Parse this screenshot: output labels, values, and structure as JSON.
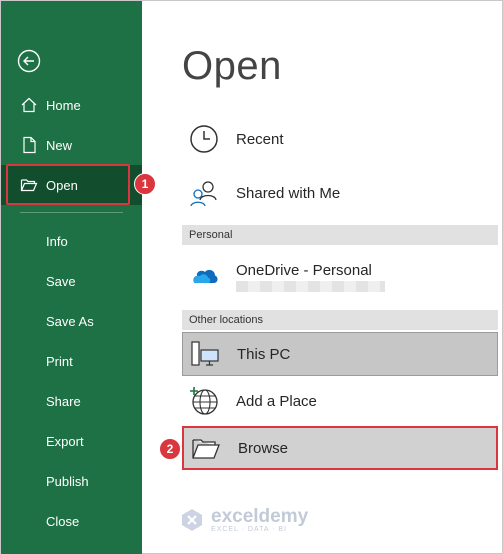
{
  "sidebar": {
    "items": [
      {
        "label": "Home",
        "icon": "home-icon"
      },
      {
        "label": "New",
        "icon": "new-document-icon"
      },
      {
        "label": "Open",
        "icon": "open-folder-icon"
      },
      {
        "label": "Info"
      },
      {
        "label": "Save"
      },
      {
        "label": "Save As"
      },
      {
        "label": "Print"
      },
      {
        "label": "Share"
      },
      {
        "label": "Export"
      },
      {
        "label": "Publish"
      },
      {
        "label": "Close"
      }
    ]
  },
  "main": {
    "title": "Open",
    "recent": "Recent",
    "shared": "Shared with Me",
    "personal_header": "Personal",
    "onedrive": "OneDrive - Personal",
    "other_header": "Other locations",
    "this_pc": "This PC",
    "add_place": "Add a Place",
    "browse": "Browse"
  },
  "annotations": {
    "step1": "1",
    "step2": "2"
  },
  "watermark": {
    "name": "exceldemy",
    "tagline": "EXCEL · DATA · BI"
  },
  "colors": {
    "sidebar_bg": "#1e7145",
    "sidebar_active": "#124e2e",
    "highlight_red": "#d9363e",
    "onedrive_blue": "#0f6cbd"
  }
}
